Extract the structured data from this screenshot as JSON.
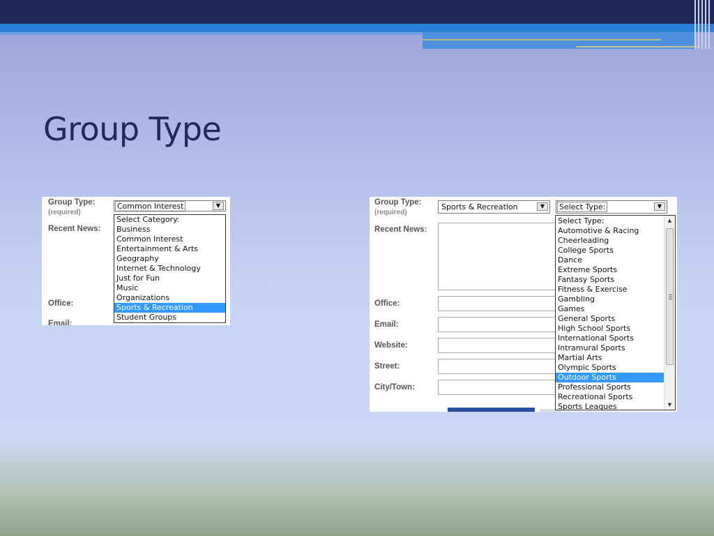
{
  "slide": {
    "title": "Group Type"
  },
  "left_form": {
    "group_type_label": "Group Type:",
    "required_label": "(required)",
    "recent_news_label": "Recent News:",
    "office_label": "Office:",
    "email_label": "Email:",
    "category_select": {
      "value": "Common Interest",
      "options": [
        "Select Category:",
        "Business",
        "Common Interest",
        "Entertainment & Arts",
        "Geography",
        "Internet & Technology",
        "Just for Fun",
        "Music",
        "Organizations",
        "Sports & Recreation",
        "Student Groups"
      ],
      "highlighted": "Sports & Recreation"
    }
  },
  "right_form": {
    "group_type_label": "Group Type:",
    "required_label": "(required)",
    "recent_news_label": "Recent News:",
    "office_label": "Office:",
    "email_label": "Email:",
    "website_label": "Website:",
    "street_label": "Street:",
    "city_label": "City/Town:",
    "category_select": {
      "value": "Sports & Recreation"
    },
    "type_select": {
      "value": "Select Type:",
      "options": [
        "Select Type:",
        "Automotive & Racing",
        "Cheerleading",
        "College Sports",
        "Dance",
        "Extreme Sports",
        "Fantasy Sports",
        "Fitness & Exercise",
        "Gambling",
        "Games",
        "General Sports",
        "High School Sports",
        "International Sports",
        "Intramural Sports",
        "Martial Arts",
        "Olympic Sports",
        "Outdoor Sports",
        "Professional Sports",
        "Recreational Sports",
        "Sports Leagues"
      ],
      "highlighted": "Outdoor Sports"
    }
  },
  "icons": {
    "dropdown_arrow": "chevron-down-icon",
    "scroll_up": "scroll-up-icon",
    "scroll_down": "scroll-down-icon"
  },
  "colors": {
    "title": "#23285a",
    "highlight": "#3399ff",
    "top_bar": "#22285a",
    "accent_band": "#2b7fd6"
  }
}
